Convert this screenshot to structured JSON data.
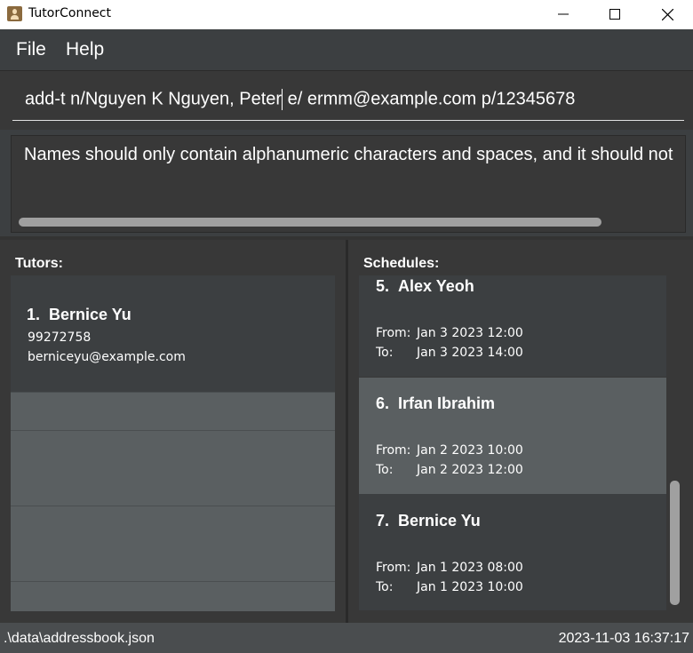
{
  "window": {
    "title": "TutorConnect"
  },
  "menu": {
    "file": "File",
    "help": "Help"
  },
  "command": {
    "value_before_caret": "add-t n/Nguyen K Nguyen, Peter",
    "value_after_caret": " e/ ermm@example.com p/12345678"
  },
  "result": {
    "text": "Names should only contain alphanumeric characters and spaces, and it should not"
  },
  "tutors": {
    "label": "Tutors:",
    "items": [
      {
        "index": "1.",
        "name": "Bernice Yu",
        "phone": "99272758",
        "email": "berniceyu@example.com"
      }
    ]
  },
  "schedules": {
    "label": "Schedules:",
    "from_label": "From:",
    "to_label": "To:",
    "items": [
      {
        "index": "5.",
        "name": "Alex Yeoh",
        "from": "Jan 3 2023 12:00",
        "to": "Jan 3 2023 14:00"
      },
      {
        "index": "6.",
        "name": "Irfan Ibrahim",
        "from": "Jan 2 2023 10:00",
        "to": "Jan 2 2023 12:00"
      },
      {
        "index": "7.",
        "name": "Bernice Yu",
        "from": "Jan 1 2023 08:00",
        "to": "Jan 1 2023 10:00"
      }
    ]
  },
  "status": {
    "path": ".\\data\\addressbook.json",
    "timestamp": "2023-11-03 16:37:17"
  },
  "colors": {
    "background": "#3c3f41",
    "panel": "#383838",
    "card_selected": "#5a5f61",
    "text": "#ffffff"
  },
  "icons": {
    "app": "tutor-app-icon",
    "minimize": "minimize-icon",
    "maximize": "maximize-icon",
    "close": "close-icon"
  }
}
